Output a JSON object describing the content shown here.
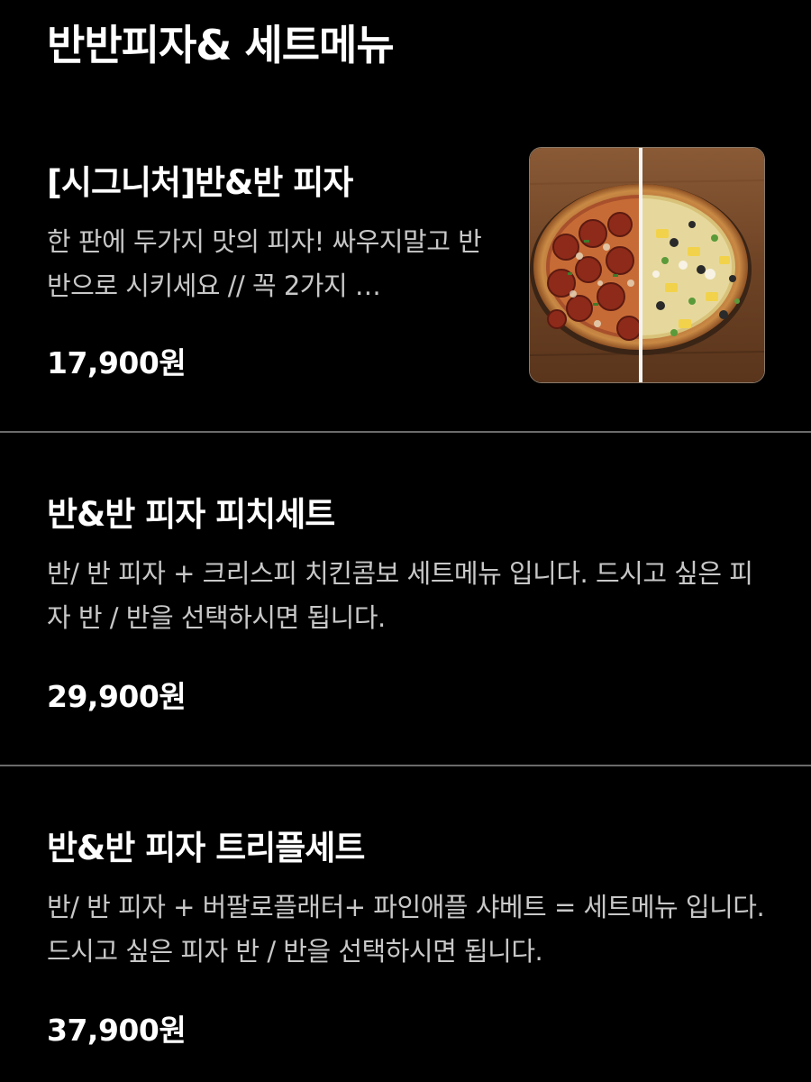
{
  "page": {
    "title": "반반피자& 세트메뉴"
  },
  "colors": {
    "background": "#000000",
    "text": "#ffffff",
    "description": "#c8c8c8",
    "divider": "#6b6b6b"
  },
  "menu_items": [
    {
      "name": "[시그니처]반&반 피자",
      "description": "한 판에 두가지 맛의 피자! 싸우지말고 반반으로 시키세요 // 꼭 2가지 …",
      "price": "17,900원",
      "image_icon": "half-and-half-pizza-image"
    },
    {
      "name": "반&반 피자 피치세트",
      "description": "반/ 반 피자 + 크리스피 치킨콤보 세트메뉴 입니다. 드시고 싶은 피자 반 / 반을 선택하시면 됩니다.",
      "price": "29,900원"
    },
    {
      "name": "반&반 피자 트리플세트",
      "description": "반/ 반 피자 + 버팔로플래터+ 파인애플 샤베트 = 세트메뉴 입니다. 드시고 싶은 피자 반 / 반을 선택하시면 됩니다.",
      "price": "37,900원"
    }
  ]
}
